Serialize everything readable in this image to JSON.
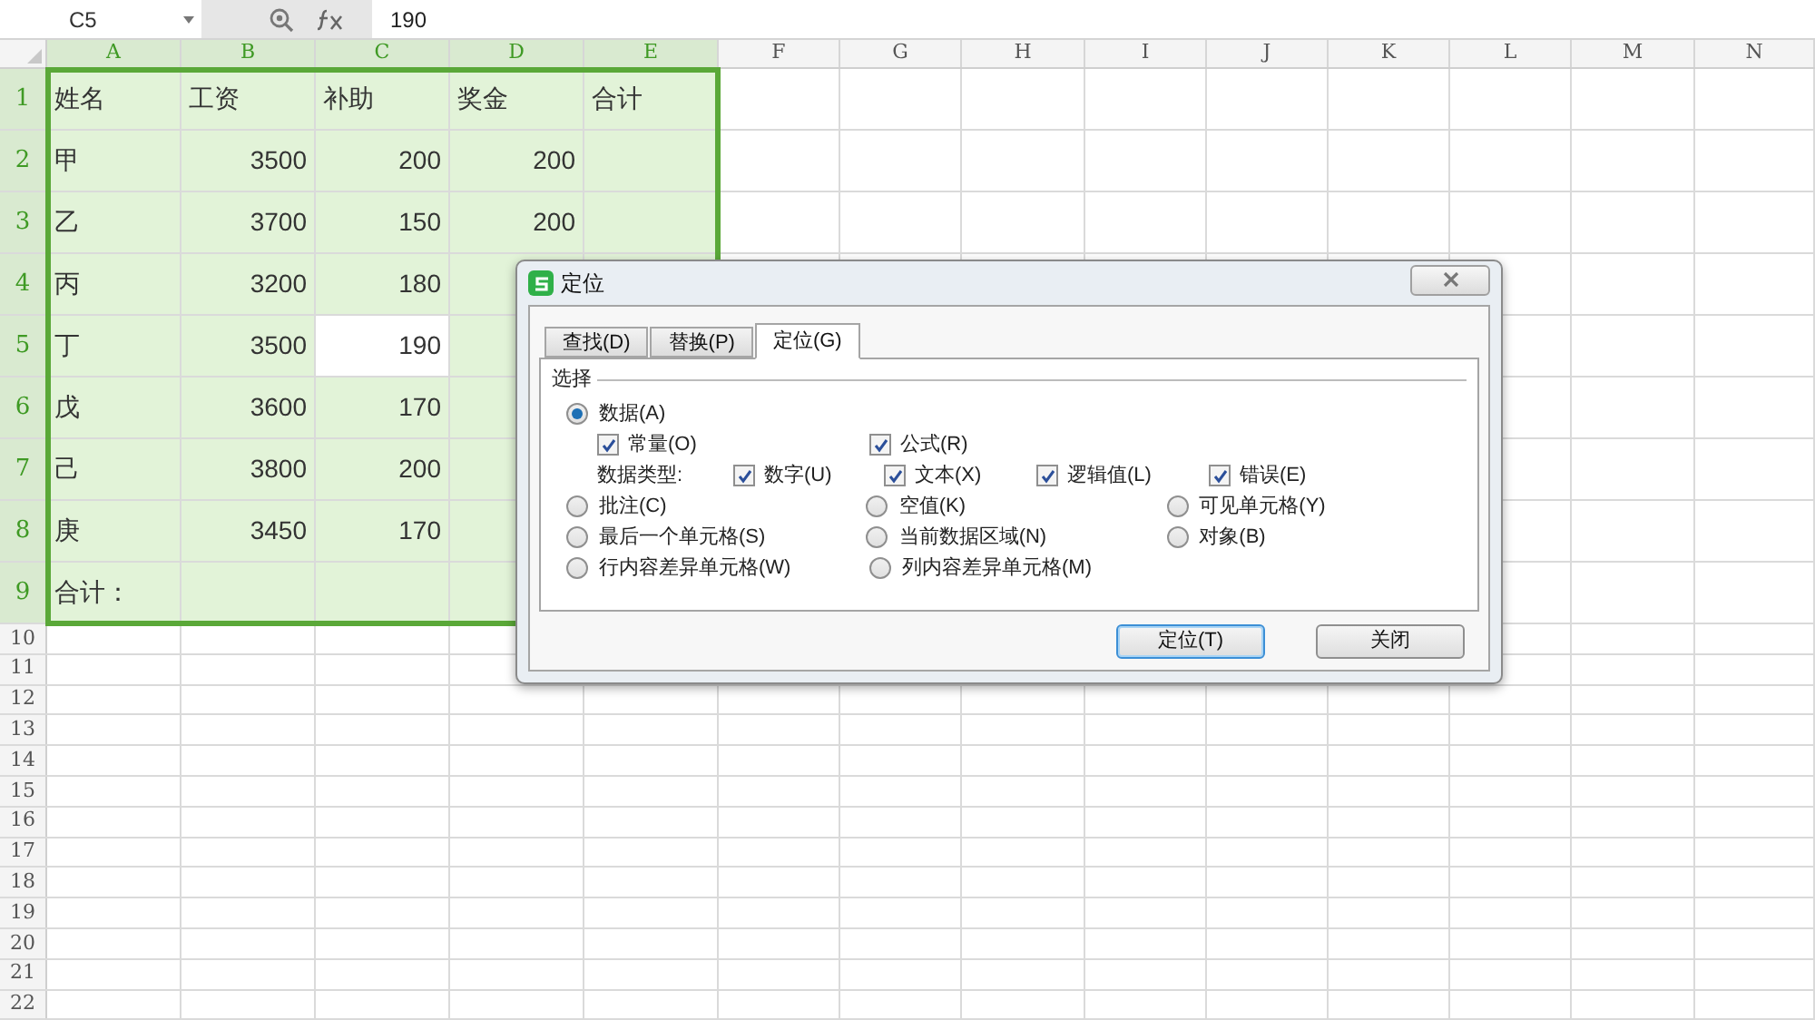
{
  "name_box": {
    "value": "C5"
  },
  "formula_bar": {
    "value": "190"
  },
  "columns": [
    {
      "label": "A",
      "selected": true
    },
    {
      "label": "B",
      "selected": true
    },
    {
      "label": "C",
      "selected": true
    },
    {
      "label": "D",
      "selected": true
    },
    {
      "label": "E",
      "selected": true
    },
    {
      "label": "F",
      "selected": false
    },
    {
      "label": "G",
      "selected": false
    },
    {
      "label": "H",
      "selected": false
    },
    {
      "label": "I",
      "selected": false
    },
    {
      "label": "J",
      "selected": false
    },
    {
      "label": "K",
      "selected": false
    },
    {
      "label": "L",
      "selected": false
    },
    {
      "label": "M",
      "selected": false
    },
    {
      "label": "N",
      "selected": false
    }
  ],
  "rows": [
    {
      "label": "1",
      "selected": true,
      "cells": [
        {
          "text": "姓名",
          "kind": "text"
        },
        {
          "text": "工资",
          "kind": "text"
        },
        {
          "text": "补助",
          "kind": "text"
        },
        {
          "text": "奖金",
          "kind": "text"
        },
        {
          "text": "合计",
          "kind": "text"
        }
      ]
    },
    {
      "label": "2",
      "selected": true,
      "cells": [
        {
          "text": "甲",
          "kind": "text"
        },
        {
          "text": "3500",
          "kind": "number"
        },
        {
          "text": "200",
          "kind": "number"
        },
        {
          "text": "200",
          "kind": "number"
        }
      ]
    },
    {
      "label": "3",
      "selected": true,
      "cells": [
        {
          "text": "乙",
          "kind": "text"
        },
        {
          "text": "3700",
          "kind": "number"
        },
        {
          "text": "150",
          "kind": "number"
        },
        {
          "text": "200",
          "kind": "number"
        }
      ]
    },
    {
      "label": "4",
      "selected": true,
      "cells": [
        {
          "text": "丙",
          "kind": "text"
        },
        {
          "text": "3200",
          "kind": "number"
        },
        {
          "text": "180",
          "kind": "number"
        }
      ]
    },
    {
      "label": "5",
      "selected": true,
      "cells": [
        {
          "text": "丁",
          "kind": "text"
        },
        {
          "text": "3500",
          "kind": "number"
        },
        {
          "text": "190",
          "kind": "number",
          "active": true
        }
      ]
    },
    {
      "label": "6",
      "selected": true,
      "cells": [
        {
          "text": "戊",
          "kind": "text"
        },
        {
          "text": "3600",
          "kind": "number"
        },
        {
          "text": "170",
          "kind": "number"
        }
      ]
    },
    {
      "label": "7",
      "selected": true,
      "cells": [
        {
          "text": "己",
          "kind": "text"
        },
        {
          "text": "3800",
          "kind": "number"
        },
        {
          "text": "200",
          "kind": "number"
        }
      ]
    },
    {
      "label": "8",
      "selected": true,
      "cells": [
        {
          "text": "庚",
          "kind": "text"
        },
        {
          "text": "3450",
          "kind": "number"
        },
        {
          "text": "170",
          "kind": "number"
        }
      ]
    },
    {
      "label": "9",
      "selected": true,
      "cells": [
        {
          "text": "合计：",
          "kind": "text"
        }
      ]
    },
    {
      "label": "10",
      "selected": false,
      "cells": []
    },
    {
      "label": "11",
      "selected": false,
      "cells": []
    },
    {
      "label": "12",
      "selected": false,
      "cells": []
    },
    {
      "label": "13",
      "selected": false,
      "cells": []
    },
    {
      "label": "14",
      "selected": false,
      "cells": []
    },
    {
      "label": "15",
      "selected": false,
      "cells": []
    },
    {
      "label": "16",
      "selected": false,
      "cells": []
    },
    {
      "label": "17",
      "selected": false,
      "cells": []
    },
    {
      "label": "18",
      "selected": false,
      "cells": []
    },
    {
      "label": "19",
      "selected": false,
      "cells": []
    },
    {
      "label": "20",
      "selected": false,
      "cells": []
    },
    {
      "label": "21",
      "selected": false,
      "cells": []
    },
    {
      "label": "22",
      "selected": false,
      "cells": []
    }
  ],
  "dialog": {
    "title": "定位",
    "tabs": [
      {
        "label": "查找(D)",
        "selected": false
      },
      {
        "label": "替换(P)",
        "selected": false
      },
      {
        "label": "定位(G)",
        "selected": true
      }
    ],
    "group_label": "选择",
    "data_option": {
      "label": "数据(A)",
      "selected": true
    },
    "data_checks": [
      {
        "label": "常量(O)",
        "checked": true
      },
      {
        "label": "公式(R)",
        "checked": true
      }
    ],
    "data_types": {
      "label": "数据类型:",
      "items": [
        {
          "label": "数字(U)",
          "checked": true
        },
        {
          "label": "文本(X)",
          "checked": true
        },
        {
          "label": "逻辑值(L)",
          "checked": true
        },
        {
          "label": "错误(E)",
          "checked": true
        }
      ]
    },
    "other_options": [
      [
        {
          "label": "批注(C)",
          "selected": false
        },
        {
          "label": "空值(K)",
          "selected": false
        },
        {
          "label": "可见单元格(Y)",
          "selected": false
        }
      ],
      [
        {
          "label": "最后一个单元格(S)",
          "selected": false
        },
        {
          "label": "当前数据区域(N)",
          "selected": false
        },
        {
          "label": "对象(B)",
          "selected": false
        }
      ],
      [
        {
          "label": "行内容差异单元格(W)",
          "selected": false
        },
        {
          "label": "列内容差异单元格(M)",
          "selected": false
        }
      ]
    ],
    "buttons": [
      {
        "label": "定位(T)",
        "kind": "default"
      },
      {
        "label": "关闭",
        "kind": "normal"
      }
    ]
  }
}
